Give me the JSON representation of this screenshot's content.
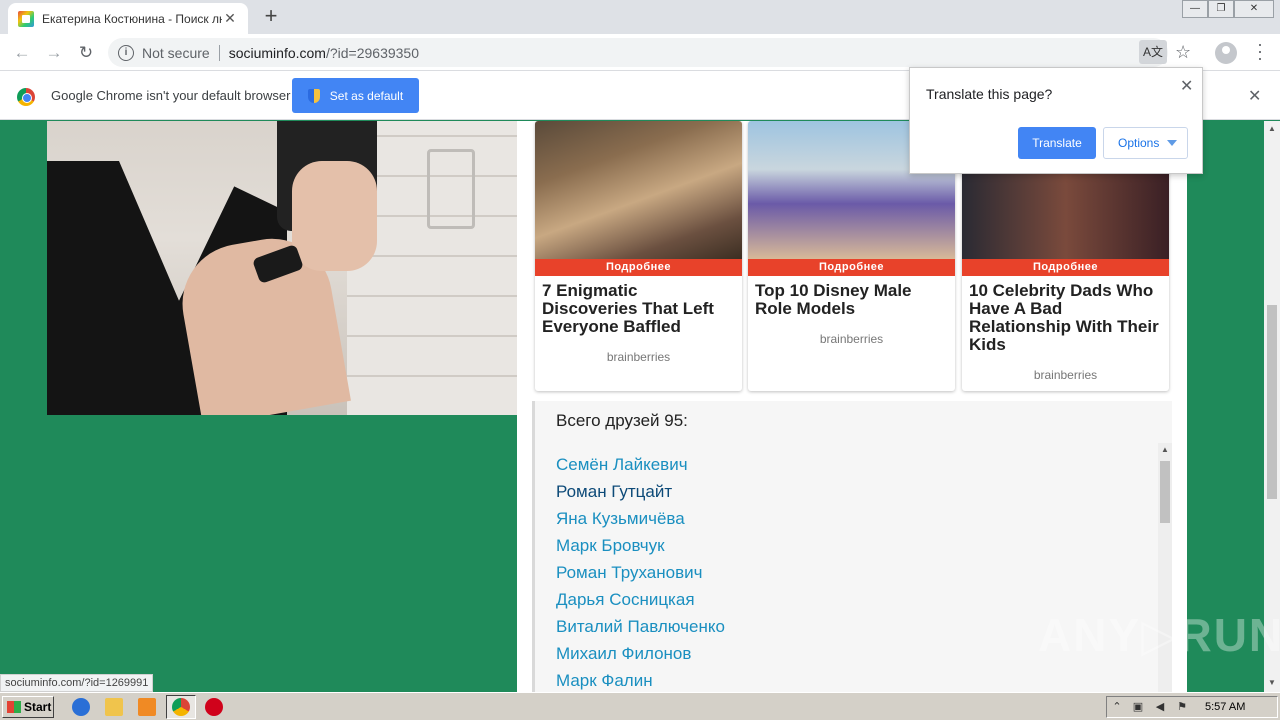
{
  "tab": {
    "title": "Екатерина Костюнина - Поиск лю",
    "close": "✕",
    "new_tab": "+"
  },
  "window": {
    "minimize": "—",
    "maximize": "❐",
    "close": "✕"
  },
  "address": {
    "security_label": "Not secure",
    "host": "sociuminfo.com",
    "path": "/?id=29639350"
  },
  "infobar": {
    "message": "Google Chrome isn't your default browser",
    "button": "Set as default",
    "close": "✕"
  },
  "translate_popup": {
    "question": "Translate this page?",
    "translate_button": "Translate",
    "options_button": "Options",
    "close": "✕"
  },
  "cards": [
    {
      "more_label": "Подробнее",
      "headline": "7 Enigmatic Discoveries That Left Everyone Baffled",
      "source": "brainberries"
    },
    {
      "more_label": "Подробнее",
      "headline": "Top 10 Disney Male Role Models",
      "source": "brainberries"
    },
    {
      "more_label": "Подробнее",
      "headline": "10 Celebrity Dads Who Have A Bad Relationship With Their Kids",
      "source": "brainberries"
    }
  ],
  "friends": {
    "heading": "Всего друзей 95:",
    "names": [
      "Семён Лайкевич",
      "Роман Гутцайт",
      "Яна Кузьмичёва",
      "Марк Бровчук",
      "Роман Труханович",
      "Дарья Сосницкая",
      "Виталий Павлюченко",
      "Михаил Филонов",
      "Марк Фалин"
    ],
    "hovered_index": 1
  },
  "status_url": "sociuminfo.com/?id=1269991",
  "watermark": "ANY▷RUN",
  "taskbar": {
    "start_label": "Start",
    "clock": "5:57 AM"
  },
  "colors": {
    "page_bg": "#1f8a5a",
    "link": "#1a8fc0",
    "accent": "#4285f4",
    "ad_label": "#e8422a"
  }
}
